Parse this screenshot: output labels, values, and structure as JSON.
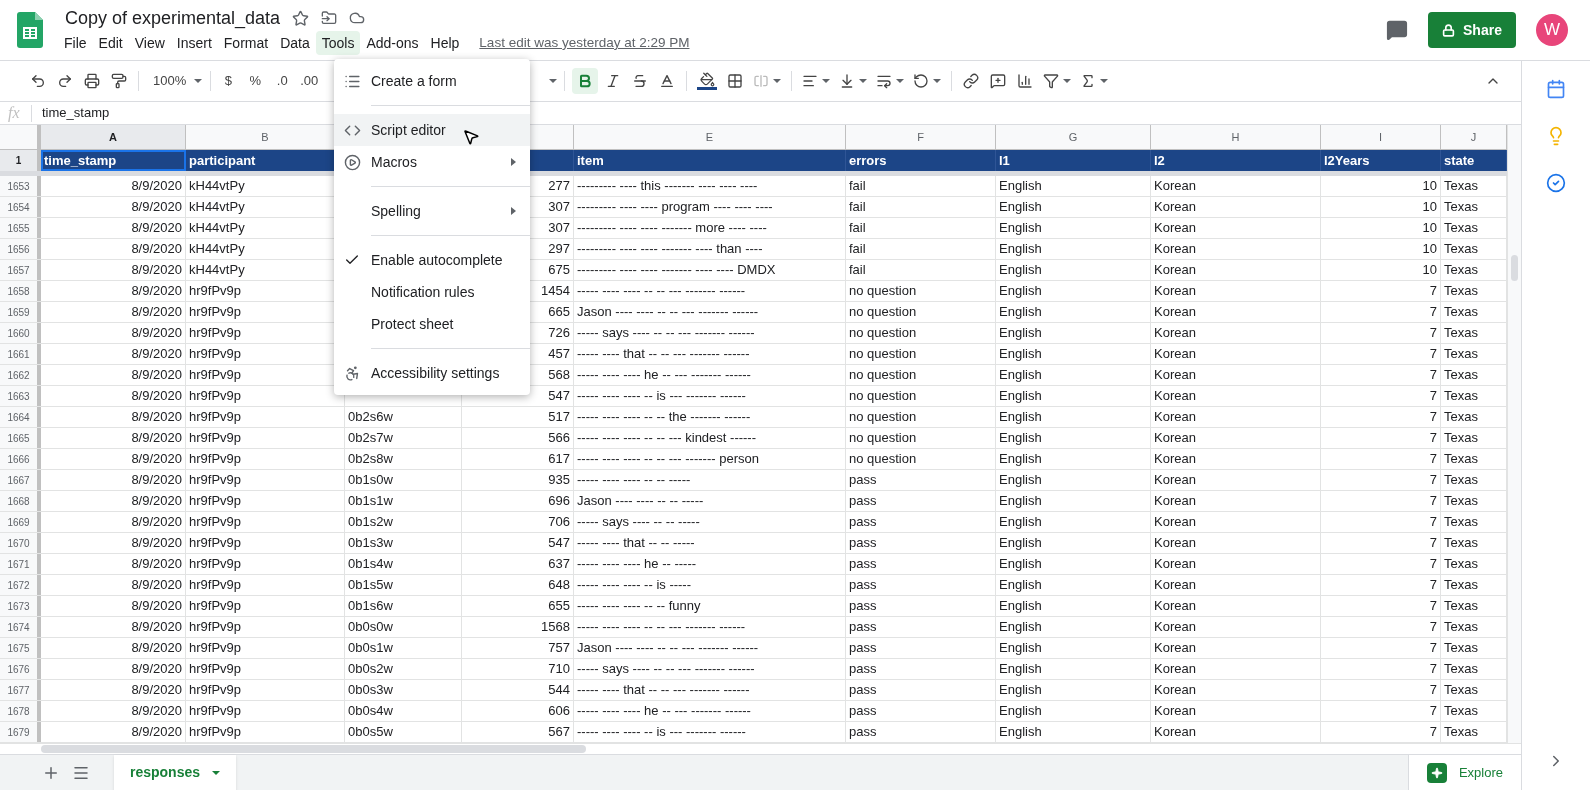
{
  "document": {
    "title": "Copy of experimental_data",
    "last_edit": "Last edit was yesterday at 2:29 PM"
  },
  "menu_bar": [
    {
      "label": "File",
      "selected": false
    },
    {
      "label": "Edit",
      "selected": false
    },
    {
      "label": "View",
      "selected": false
    },
    {
      "label": "Insert",
      "selected": false
    },
    {
      "label": "Format",
      "selected": false
    },
    {
      "label": "Data",
      "selected": false
    },
    {
      "label": "Tools",
      "selected": true
    },
    {
      "label": "Add-ons",
      "selected": false
    },
    {
      "label": "Help",
      "selected": false
    }
  ],
  "share_button": "Share",
  "avatar": "W",
  "toolbar": {
    "zoom": "100%",
    "currency": "$",
    "percent": "%",
    "decrease_decimals": ".0",
    "increase_decimals": ".00",
    "bold": true
  },
  "formula_bar": {
    "label": "fx",
    "value": "time_stamp"
  },
  "columns": [
    {
      "letter": "A",
      "heading": "time_stamp",
      "selected": true
    },
    {
      "letter": "B",
      "heading": "participant",
      "selected": false
    },
    {},
    {},
    {
      "letter": "E",
      "heading": "item",
      "selected": false
    },
    {
      "letter": "F",
      "heading": "errors",
      "selected": false
    },
    {
      "letter": "G",
      "heading": "l1",
      "selected": false
    },
    {
      "letter": "H",
      "heading": "l2",
      "selected": false
    },
    {
      "letter": "I",
      "heading": "l2Years",
      "selected": false
    },
    {
      "letter": "J",
      "heading": "state",
      "selected": false
    }
  ],
  "header_row_number": "1",
  "rows": [
    {
      "number": "1653",
      "time_stamp": "8/9/2020",
      "participant": "kH44vtPy",
      "column_d": "277",
      "item": "--------- ---- this ------- ---- ---- ----",
      "errors": "fail",
      "l1": "English",
      "l2": "Korean",
      "l2Years": "10",
      "state": "Texas"
    },
    {
      "number": "1654",
      "time_stamp": "8/9/2020",
      "participant": "kH44vtPy",
      "column_d": "307",
      "item": "--------- ---- ---- program ---- ---- ----",
      "errors": "fail",
      "l1": "English",
      "l2": "Korean",
      "l2Years": "10",
      "state": "Texas"
    },
    {
      "number": "1655",
      "time_stamp": "8/9/2020",
      "participant": "kH44vtPy",
      "column_d": "307",
      "item": "--------- ---- ---- ------- more ---- ----",
      "errors": "fail",
      "l1": "English",
      "l2": "Korean",
      "l2Years": "10",
      "state": "Texas"
    },
    {
      "number": "1656",
      "time_stamp": "8/9/2020",
      "participant": "kH44vtPy",
      "column_d": "297",
      "item": "--------- ---- ---- ------- ---- than ----",
      "errors": "fail",
      "l1": "English",
      "l2": "Korean",
      "l2Years": "10",
      "state": "Texas"
    },
    {
      "number": "1657",
      "time_stamp": "8/9/2020",
      "participant": "kH44vtPy",
      "column_d": "675",
      "item": "--------- ---- ---- ------- ---- ---- DMDX",
      "errors": "fail",
      "l1": "English",
      "l2": "Korean",
      "l2Years": "10",
      "state": "Texas"
    },
    {
      "number": "1658",
      "time_stamp": "8/9/2020",
      "participant": "hr9fPv9p",
      "column_d": "1454",
      "item": "----- ---- ---- -- -- --- ------- ------",
      "errors": "no question",
      "l1": "English",
      "l2": "Korean",
      "l2Years": "7",
      "state": "Texas"
    },
    {
      "number": "1659",
      "time_stamp": "8/9/2020",
      "participant": "hr9fPv9p",
      "column_d": "665",
      "item": "Jason ---- ---- -- -- --- ------- ------",
      "errors": "no question",
      "l1": "English",
      "l2": "Korean",
      "l2Years": "7",
      "state": "Texas"
    },
    {
      "number": "1660",
      "time_stamp": "8/9/2020",
      "participant": "hr9fPv9p",
      "column_d": "726",
      "item": "----- says ---- -- -- --- ------- ------",
      "errors": "no question",
      "l1": "English",
      "l2": "Korean",
      "l2Years": "7",
      "state": "Texas"
    },
    {
      "number": "1661",
      "time_stamp": "8/9/2020",
      "participant": "hr9fPv9p",
      "column_d": "457",
      "item": "----- ---- that -- -- --- ------- ------",
      "errors": "no question",
      "l1": "English",
      "l2": "Korean",
      "l2Years": "7",
      "state": "Texas"
    },
    {
      "number": "1662",
      "time_stamp": "8/9/2020",
      "participant": "hr9fPv9p",
      "column_d": "568",
      "item": "----- ---- ---- he -- --- ------- ------",
      "errors": "no question",
      "l1": "English",
      "l2": "Korean",
      "l2Years": "7",
      "state": "Texas"
    },
    {
      "number": "1663",
      "time_stamp": "8/9/2020",
      "participant": "hr9fPv9p",
      "column_d": "547",
      "item": "----- ---- ---- -- is --- ------- ------",
      "errors": "no question",
      "l1": "English",
      "l2": "Korean",
      "l2Years": "7",
      "state": "Texas"
    },
    {
      "number": "1664",
      "time_stamp": "8/9/2020",
      "participant": "hr9fPv9p",
      "column_c": "0b2s6w",
      "column_d": "517",
      "item": "----- ---- ---- -- -- the ------- ------",
      "errors": "no question",
      "l1": "English",
      "l2": "Korean",
      "l2Years": "7",
      "state": "Texas"
    },
    {
      "number": "1665",
      "time_stamp": "8/9/2020",
      "participant": "hr9fPv9p",
      "column_c": "0b2s7w",
      "column_d": "566",
      "item": "----- ---- ---- -- -- --- kindest ------",
      "errors": "no question",
      "l1": "English",
      "l2": "Korean",
      "l2Years": "7",
      "state": "Texas"
    },
    {
      "number": "1666",
      "time_stamp": "8/9/2020",
      "participant": "hr9fPv9p",
      "column_c": "0b2s8w",
      "column_d": "617",
      "item": "----- ---- ---- -- -- --- ------- person",
      "errors": "no question",
      "l1": "English",
      "l2": "Korean",
      "l2Years": "7",
      "state": "Texas"
    },
    {
      "number": "1667",
      "time_stamp": "8/9/2020",
      "participant": "hr9fPv9p",
      "column_c": "0b1s0w",
      "column_d": "935",
      "item": "----- ---- ---- -- -- -----",
      "errors": "pass",
      "l1": "English",
      "l2": "Korean",
      "l2Years": "7",
      "state": "Texas"
    },
    {
      "number": "1668",
      "time_stamp": "8/9/2020",
      "participant": "hr9fPv9p",
      "column_c": "0b1s1w",
      "column_d": "696",
      "item": "Jason ---- ---- -- -- -----",
      "errors": "pass",
      "l1": "English",
      "l2": "Korean",
      "l2Years": "7",
      "state": "Texas"
    },
    {
      "number": "1669",
      "time_stamp": "8/9/2020",
      "participant": "hr9fPv9p",
      "column_c": "0b1s2w",
      "column_d": "706",
      "item": "----- says ---- -- -- -----",
      "errors": "pass",
      "l1": "English",
      "l2": "Korean",
      "l2Years": "7",
      "state": "Texas"
    },
    {
      "number": "1670",
      "time_stamp": "8/9/2020",
      "participant": "hr9fPv9p",
      "column_c": "0b1s3w",
      "column_d": "547",
      "item": "----- ---- that -- -- -----",
      "errors": "pass",
      "l1": "English",
      "l2": "Korean",
      "l2Years": "7",
      "state": "Texas"
    },
    {
      "number": "1671",
      "time_stamp": "8/9/2020",
      "participant": "hr9fPv9p",
      "column_c": "0b1s4w",
      "column_d": "637",
      "item": "----- ---- ---- he -- -----",
      "errors": "pass",
      "l1": "English",
      "l2": "Korean",
      "l2Years": "7",
      "state": "Texas"
    },
    {
      "number": "1672",
      "time_stamp": "8/9/2020",
      "participant": "hr9fPv9p",
      "column_c": "0b1s5w",
      "column_d": "648",
      "item": "----- ---- ---- -- is -----",
      "errors": "pass",
      "l1": "English",
      "l2": "Korean",
      "l2Years": "7",
      "state": "Texas"
    },
    {
      "number": "1673",
      "time_stamp": "8/9/2020",
      "participant": "hr9fPv9p",
      "column_c": "0b1s6w",
      "column_d": "655",
      "item": "----- ---- ---- -- -- funny",
      "errors": "pass",
      "l1": "English",
      "l2": "Korean",
      "l2Years": "7",
      "state": "Texas"
    },
    {
      "number": "1674",
      "time_stamp": "8/9/2020",
      "participant": "hr9fPv9p",
      "column_c": "0b0s0w",
      "column_d": "1568",
      "item": "----- ---- ---- -- -- --- ------- ------",
      "errors": "pass",
      "l1": "English",
      "l2": "Korean",
      "l2Years": "7",
      "state": "Texas"
    },
    {
      "number": "1675",
      "time_stamp": "8/9/2020",
      "participant": "hr9fPv9p",
      "column_c": "0b0s1w",
      "column_d": "757",
      "item": "Jason ---- ---- -- -- --- ------- ------",
      "errors": "pass",
      "l1": "English",
      "l2": "Korean",
      "l2Years": "7",
      "state": "Texas"
    },
    {
      "number": "1676",
      "time_stamp": "8/9/2020",
      "participant": "hr9fPv9p",
      "column_c": "0b0s2w",
      "column_d": "710",
      "item": "----- says ---- -- -- --- ------- ------",
      "errors": "pass",
      "l1": "English",
      "l2": "Korean",
      "l2Years": "7",
      "state": "Texas"
    },
    {
      "number": "1677",
      "time_stamp": "8/9/2020",
      "participant": "hr9fPv9p",
      "column_c": "0b0s3w",
      "column_d": "544",
      "item": "----- ---- that -- -- --- ------- ------",
      "errors": "pass",
      "l1": "English",
      "l2": "Korean",
      "l2Years": "7",
      "state": "Texas"
    },
    {
      "number": "1678",
      "time_stamp": "8/9/2020",
      "participant": "hr9fPv9p",
      "column_c": "0b0s4w",
      "column_d": "606",
      "item": "----- ---- ---- he -- --- ------- ------",
      "errors": "pass",
      "l1": "English",
      "l2": "Korean",
      "l2Years": "7",
      "state": "Texas"
    },
    {
      "number": "1679",
      "time_stamp": "8/9/2020",
      "participant": "hr9fPv9p",
      "column_c": "0b0s5w",
      "column_d": "567",
      "item": "----- ---- ---- -- is --- ------- ------",
      "errors": "pass",
      "l1": "English",
      "l2": "Korean",
      "l2Years": "7",
      "state": "Texas"
    }
  ],
  "tools_menu": [
    {
      "kind": "item",
      "label": "Create a form",
      "selected": false,
      "checked": false,
      "submenu": false
    },
    {
      "kind": "divider"
    },
    {
      "kind": "item",
      "label": "Script editor",
      "selected": true,
      "checked": false,
      "submenu": false
    },
    {
      "kind": "item",
      "label": "Macros",
      "selected": false,
      "checked": false,
      "submenu": true
    },
    {
      "kind": "divider"
    },
    {
      "kind": "item",
      "label": "Spelling",
      "selected": false,
      "checked": false,
      "submenu": true
    },
    {
      "kind": "divider"
    },
    {
      "kind": "item",
      "label": "Enable autocomplete",
      "selected": false,
      "checked": true,
      "submenu": false
    },
    {
      "kind": "item",
      "label": "Notification rules",
      "selected": false,
      "checked": false,
      "submenu": false
    },
    {
      "kind": "item",
      "label": "Protect sheet",
      "selected": false,
      "checked": false,
      "submenu": false
    },
    {
      "kind": "divider"
    },
    {
      "kind": "item",
      "label": "Accessibility settings",
      "selected": false,
      "checked": false,
      "submenu": false
    }
  ],
  "sheet_tabs": [
    {
      "label": "responses",
      "selected": true
    }
  ],
  "explore_button": "Explore"
}
